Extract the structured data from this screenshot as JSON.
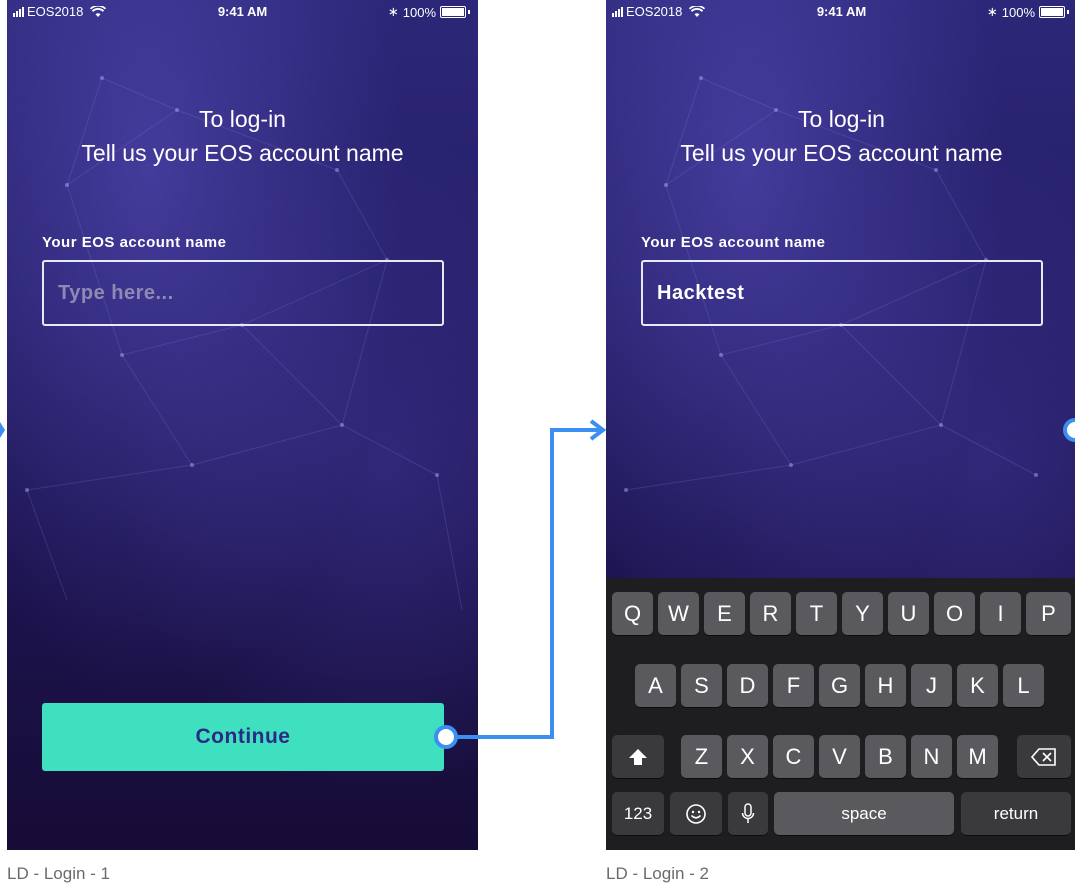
{
  "status_bar": {
    "carrier": "EOS2018",
    "time": "9:41 AM",
    "battery_percent": "100%",
    "icons": [
      "signal-bars-icon",
      "wifi-icon",
      "bluetooth-icon",
      "battery-icon"
    ]
  },
  "screens": [
    {
      "caption": "LD - Login - 1",
      "heading_line1": "To log-in",
      "heading_line2": "Tell us your EOS account name",
      "field_label": "Your EOS account name",
      "field_placeholder": "Type here...",
      "continue_label": "Continue"
    },
    {
      "caption": "LD - Login - 2",
      "heading_line1": "To log-in",
      "heading_line2": "Tell us your EOS account name",
      "field_label": "Your EOS account name",
      "field_value": "Hacktest"
    }
  ],
  "keyboard": {
    "row1": [
      "Q",
      "W",
      "E",
      "R",
      "T",
      "Y",
      "U",
      "O",
      "I",
      "P"
    ],
    "row2": [
      "A",
      "S",
      "D",
      "F",
      "G",
      "H",
      "J",
      "K",
      "L"
    ],
    "row3": [
      "Z",
      "X",
      "C",
      "V",
      "B",
      "N",
      "M"
    ],
    "key_123": "123",
    "key_space": "space",
    "key_return": "return"
  },
  "colors": {
    "accent_button": "#3ee0c0",
    "button_text": "#2b2a84",
    "background_top": "#2c2778",
    "background_bottom": "#170c36",
    "connector": "#3b8ff0"
  }
}
